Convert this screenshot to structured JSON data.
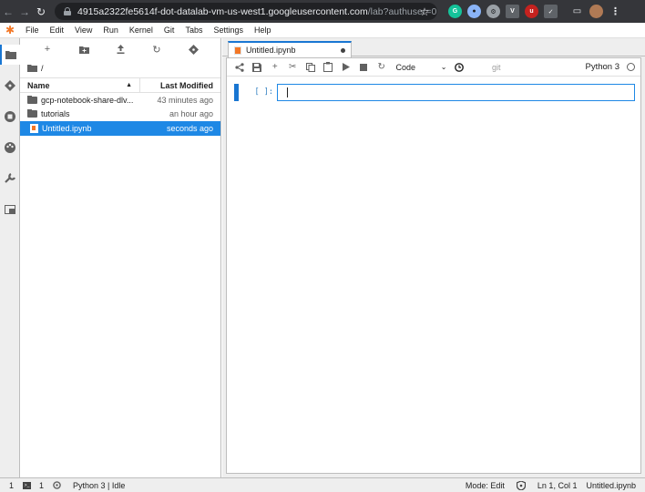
{
  "browser": {
    "url_host": "4915a2322fe5614f-dot-datalab-vm-us-west1.googleusercontent.com",
    "url_path": "/lab?authuser=0"
  },
  "menubar": {
    "items": [
      "File",
      "Edit",
      "View",
      "Run",
      "Kernel",
      "Git",
      "Tabs",
      "Settings",
      "Help"
    ]
  },
  "filebrowser": {
    "breadcrumb": "/",
    "columns": {
      "name": "Name",
      "modified": "Last Modified"
    },
    "rows": [
      {
        "name": "gcp-notebook-share-dlv...",
        "modified": "43 minutes ago",
        "kind": "folder",
        "selected": false
      },
      {
        "name": "tutorials",
        "modified": "an hour ago",
        "kind": "folder",
        "selected": false
      },
      {
        "name": "Untitled.ipynb",
        "modified": "seconds ago",
        "kind": "notebook",
        "selected": true
      }
    ]
  },
  "notebook": {
    "tab_title": "Untitled.ipynb",
    "cell_type": "Code",
    "git_label": "git",
    "kernel_name": "Python 3",
    "cell_prompt": "[ ]:"
  },
  "statusbar": {
    "count_left": "1",
    "terminal_count": "1",
    "kernel": "Python 3 | Idle",
    "mode": "Mode: Edit",
    "position": "Ln 1, Col 1",
    "file": "Untitled.ipynb"
  },
  "colors": {
    "accent": "#1976d2",
    "selection": "#1e88e5",
    "jupyter_orange": "#f37726"
  }
}
